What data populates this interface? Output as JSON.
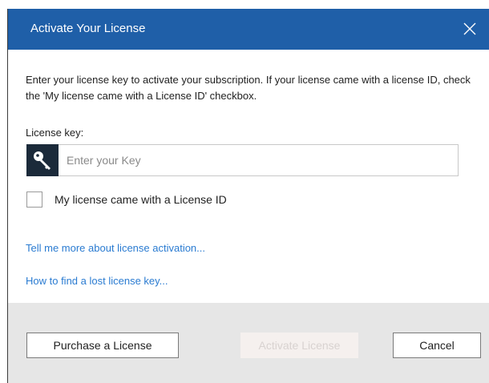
{
  "dialog": {
    "title": "Activate Your License",
    "close_icon": "close-icon",
    "colors": {
      "titlebar": "#1f5fa8",
      "link": "#2a7bd1",
      "footer": "#e6e6e6"
    }
  },
  "body": {
    "intro": "Enter your license key to activate your subscription. If your license came with a license ID, check the 'My license came with a License ID' checkbox.",
    "license_key_label": "License key:",
    "key_icon": "key-icon",
    "license_key_placeholder": "Enter your Key",
    "license_key_value": "",
    "license_id_checkbox_label": "My license came with a License ID",
    "license_id_checked": false,
    "link_more_info": "Tell me more about license activation...",
    "link_lost_key": "How to find a lost license key..."
  },
  "footer": {
    "purchase_label": "Purchase a License",
    "activate_label": "Activate License",
    "activate_enabled": false,
    "cancel_label": "Cancel"
  }
}
